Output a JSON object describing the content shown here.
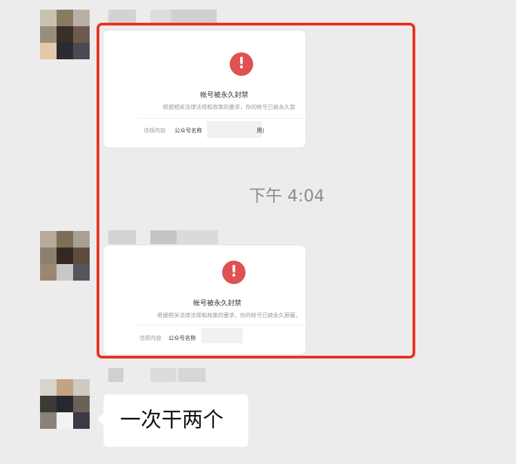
{
  "messages": [
    {
      "type": "card",
      "card": {
        "title": "帐号被永久封禁",
        "description": "根据相关法律法规和政策的要求，你的帐号已被永久禁",
        "violation_label": "违规内容",
        "violation_value": "公众号名称",
        "violation_suffix": "用)"
      }
    },
    {
      "type": "card",
      "card": {
        "title": "帐号被永久封禁",
        "description": "根据相关法律法规和政策的要求，你的帐号已被永久屏蔽，",
        "violation_label": "违规内容",
        "violation_value": "公众号名称",
        "violation_suffix": ""
      }
    },
    {
      "type": "text",
      "text": "一次干两个"
    }
  ],
  "timestamp": "下午 4:04",
  "colors": {
    "highlight": "#e8331e",
    "warning": "#e05252",
    "background": "#ececec"
  },
  "icons": [
    "warning-icon"
  ]
}
